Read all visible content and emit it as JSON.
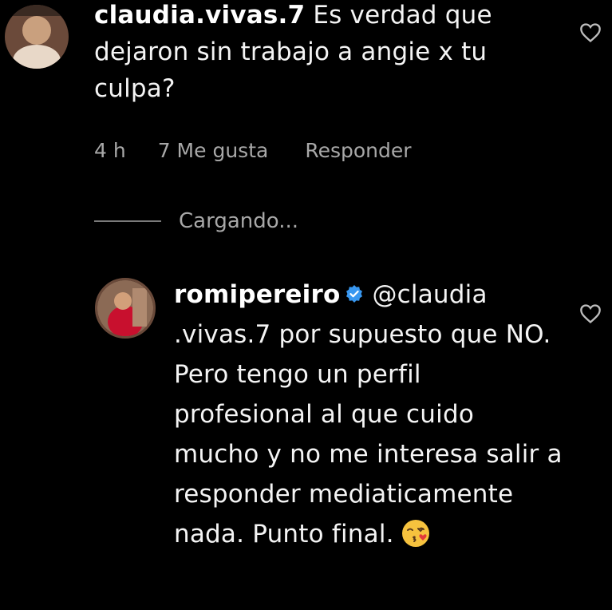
{
  "comments": [
    {
      "username": "claudia.vivas.7",
      "text": "Es verdad que dejaron sin trabajo a angie x tu culpa?",
      "time": "4 h",
      "likes": "7 Me gusta",
      "reply_label": "Responder"
    },
    {
      "loading_label": "Cargando..."
    },
    {
      "username": "romipereiro",
      "verified": true,
      "text": "@claudia .vivas.7 por supuesto que NO. Pero tengo un perfil profesional al que cuido mucho y no me interesa salir a responder mediaticamente nada. Punto final.",
      "emoji": "kissing-face-emoji"
    }
  ],
  "icons": {
    "like": "heart-icon",
    "verified": "verified-badge-icon"
  },
  "colors": {
    "background": "#000000",
    "text": "#f4f4f4",
    "meta": "#a8a8a8",
    "verified": "#3897f0"
  }
}
